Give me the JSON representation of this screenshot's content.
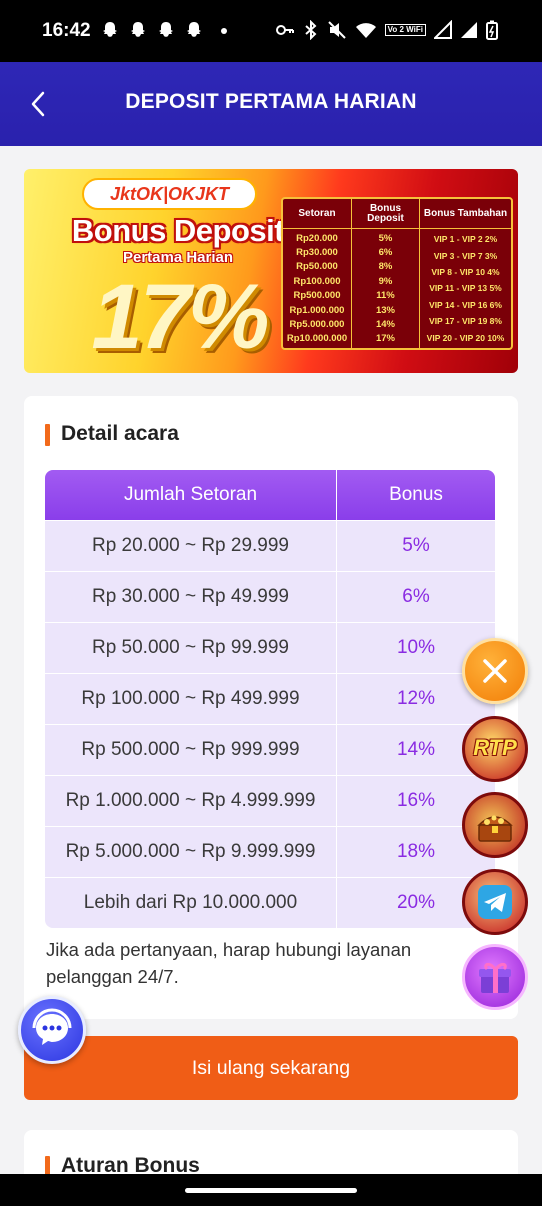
{
  "status_bar": {
    "time": "16:42",
    "icons": [
      "snapchat-ghost-icon",
      "snapchat-ghost-icon",
      "snapchat-ghost-icon",
      "snapchat-ghost-icon",
      "dot",
      "key-icon",
      "bluetooth-icon",
      "mute-icon",
      "wifi-icon",
      "volte-icon",
      "signal-icon",
      "signal-icon",
      "battery-icon"
    ],
    "volte_label": "Vo 2 WiFi"
  },
  "header": {
    "title": "DEPOSIT PERTAMA HARIAN",
    "background": "#2e27b6"
  },
  "banner": {
    "brand": "JktOK|OKJKT",
    "title": "Bonus Deposit",
    "subtitle": "Pertama Harian",
    "percent": "17%",
    "table_headers": [
      "Setoran",
      "Bonus Deposit",
      "Bonus Tambahan"
    ],
    "setoran": [
      "Rp20.000",
      "Rp30.000",
      "Rp50.000",
      "Rp100.000",
      "Rp500.000",
      "Rp1.000.000",
      "Rp5.000.000",
      "Rp10.000.000"
    ],
    "bonus_deposit": [
      "5%",
      "6%",
      "8%",
      "9%",
      "11%",
      "13%",
      "14%",
      "17%"
    ],
    "bonus_tambahan": [
      "VIP 1 - VIP 2  2%",
      "VIP 3 - VIP 7  3%",
      "VIP 8 - VIP 10  4%",
      "VIP 11 - VIP 13  5%",
      "VIP 14 - VIP 16  6%",
      "VIP 17 - VIP 19  8%",
      "VIP 20 - VIP 20  10%"
    ]
  },
  "detail": {
    "title": "Detail acara",
    "columns": [
      "Jumlah Setoran",
      "Bonus"
    ],
    "rows": [
      {
        "range": "Rp 20.000 ~ Rp 29.999",
        "bonus": "5%"
      },
      {
        "range": "Rp 30.000 ~ Rp 49.999",
        "bonus": "6%"
      },
      {
        "range": "Rp 50.000 ~ Rp 99.999",
        "bonus": "10%"
      },
      {
        "range": "Rp 100.000 ~ Rp 499.999",
        "bonus": "12%"
      },
      {
        "range": "Rp 500.000 ~ Rp 999.999",
        "bonus": "14%"
      },
      {
        "range": "Rp 1.000.000 ~ Rp 4.999.999",
        "bonus": "16%"
      },
      {
        "range": "Rp 5.000.000 ~ Rp 9.999.999",
        "bonus": "18%"
      },
      {
        "range": "Lebih dari Rp 10.000.000",
        "bonus": "20%"
      }
    ],
    "note": "Jika ada pertanyaan, harap hubungi layanan pelanggan 24/7."
  },
  "cta": {
    "label": "Isi ulang sekarang",
    "color": "#f05d16"
  },
  "rules": {
    "title": "Aturan Bonus"
  },
  "floating": {
    "rtp_label": "RTP",
    "icons": [
      "close-icon",
      "rtp-icon",
      "treasure-chest-icon",
      "telegram-icon",
      "gift-box-icon",
      "customer-service-chat-icon"
    ]
  },
  "accent": "#8a3eea"
}
